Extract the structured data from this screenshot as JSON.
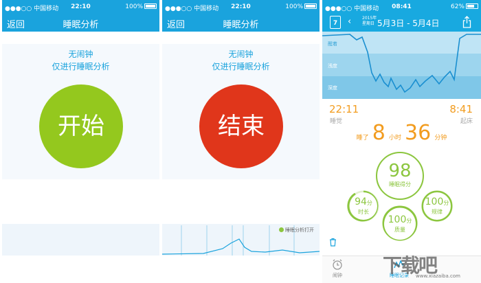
{
  "status": {
    "carrier": "●●●○○ 中国移动",
    "battery": "100%"
  },
  "panel1": {
    "time": "22:10",
    "back": "返回",
    "title": "睡眠分析",
    "message": [
      "无闹钟",
      "仅进行睡眠分析"
    ],
    "button": "开始"
  },
  "panel2": {
    "time": "22:10",
    "back": "返回",
    "title": "睡眠分析",
    "message": [
      "无闹钟",
      "仅进行睡眠分析"
    ],
    "button": "结束",
    "legend": "睡眠分析打开"
  },
  "panel3": {
    "status": {
      "carrier": "●●●○○ 中国移动",
      "time": "08:41",
      "battery": "62%"
    },
    "cal_day": "7",
    "year": "2015年",
    "weekday": "星期日",
    "range": "5月3日 - 5月4日",
    "band_labels": [
      "醒着",
      "浅度",
      "深度"
    ],
    "sleep_time": "22:11",
    "sleep_label": "睡觉",
    "wake_time": "8:41",
    "wake_label": "起床",
    "duration": {
      "prefix": "睡了",
      "hours": "8",
      "hours_unit": "小时",
      "minutes": "36",
      "minutes_unit": "分钟"
    },
    "scores": {
      "main": {
        "value": "98",
        "label": "睡眠得分"
      },
      "length": {
        "value": "94",
        "unit": "分",
        "label": "时长"
      },
      "regularity": {
        "value": "100",
        "unit": "分",
        "label": "规律"
      },
      "quality": {
        "value": "100",
        "unit": "分",
        "label": "质量"
      }
    },
    "tabs": [
      "闹钟",
      "睡眠记录"
    ],
    "watermark": "下载吧",
    "watermark_url": "www.xiazaiba.com"
  },
  "colors": {
    "accent": "#1aa3dd",
    "start": "#94c81e",
    "stop": "#e0361b",
    "orange": "#f29c1f",
    "green": "#8cc63f"
  }
}
